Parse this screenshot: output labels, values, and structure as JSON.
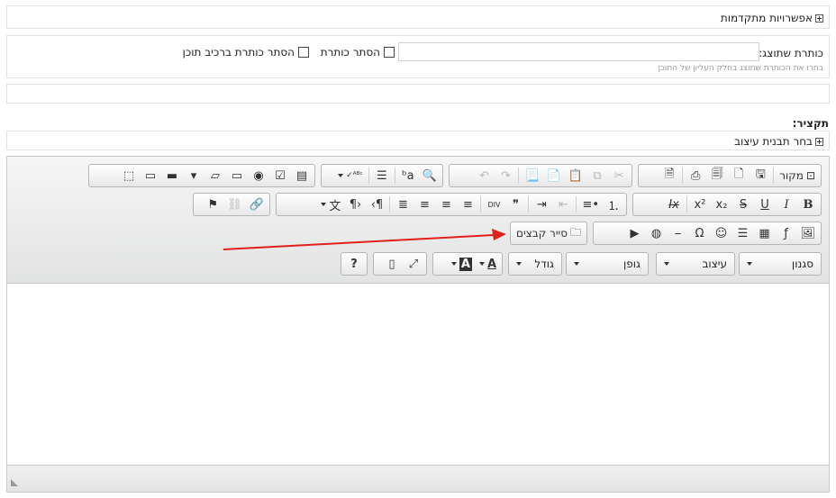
{
  "advanced": {
    "label": "אפשרויות מתקדמות"
  },
  "title_section": {
    "label": "כותרת שתוצג:",
    "input_value": "",
    "help": "בחרו את הכותרת שתוצג בחלק העליון של התוכן",
    "hide_title": "הסתר כותרת",
    "hide_title_in_component": "הסתר כותרת ברכיב תוכן"
  },
  "summary": {
    "label": "תקציר:"
  },
  "template": {
    "label": "בחר תבנית עיצוב"
  },
  "toolbar": {
    "source_label": "מקור",
    "file_browser_label": "סייר קבצים",
    "style_combo": "סגנון",
    "format_combo": "עיצוב",
    "font_combo": "גופן",
    "size_combo": "גודל",
    "glyphs": {
      "source_icon": "⊡",
      "save": "🖫",
      "newpage": "🗋",
      "preview": "🗐",
      "print": "⎙",
      "templates": "🗎",
      "cut": "✂",
      "copy": "⧉",
      "paste": "📋",
      "paste_text": "📄",
      "paste_word": "📃",
      "undo": "↶",
      "redo": "↷",
      "find": "🔍",
      "replace": "ᵇa",
      "select_all": "☰",
      "spellcheck": "ᴬᴮᶜ✓",
      "form": "▤",
      "checkbox": "☑",
      "radio": "◉",
      "textfield": "▭",
      "textarea": "▱",
      "select": "▾",
      "button": "▬",
      "imagebutton": "▭",
      "hiddenfield": "⬚",
      "bold": "B",
      "italic": "I",
      "underline": "U",
      "strike": "S",
      "subscript": "x₂",
      "superscript": "x²",
      "removeformat": "Ix",
      "numbered": "⒈",
      "bulleted": "•≡",
      "outdent": "⇤",
      "indent": "⇥",
      "blockquote": "❞",
      "div": "DIV",
      "align_left": "≡",
      "align_center": "≡",
      "align_right": "≡",
      "justify": "≣",
      "ltr": "¶›",
      "rtl": "‹¶",
      "language": "文",
      "link": "🔗",
      "unlink": "⛓",
      "anchor": "⚑",
      "image": "🖼",
      "flash": "ƒ",
      "table": "▦",
      "hline": "☰",
      "smiley": "☺",
      "specialchar": "Ω",
      "pagebreak": "⎯",
      "iframe": "◍",
      "youtube": "▶",
      "folder": "🗀",
      "textcolor": "A",
      "bgcolor": "A",
      "maximize": "⤢",
      "showblocks": "▯",
      "help": "?"
    }
  },
  "colors": {
    "arrow": "#e0201b",
    "border": "#c6c9cc"
  }
}
